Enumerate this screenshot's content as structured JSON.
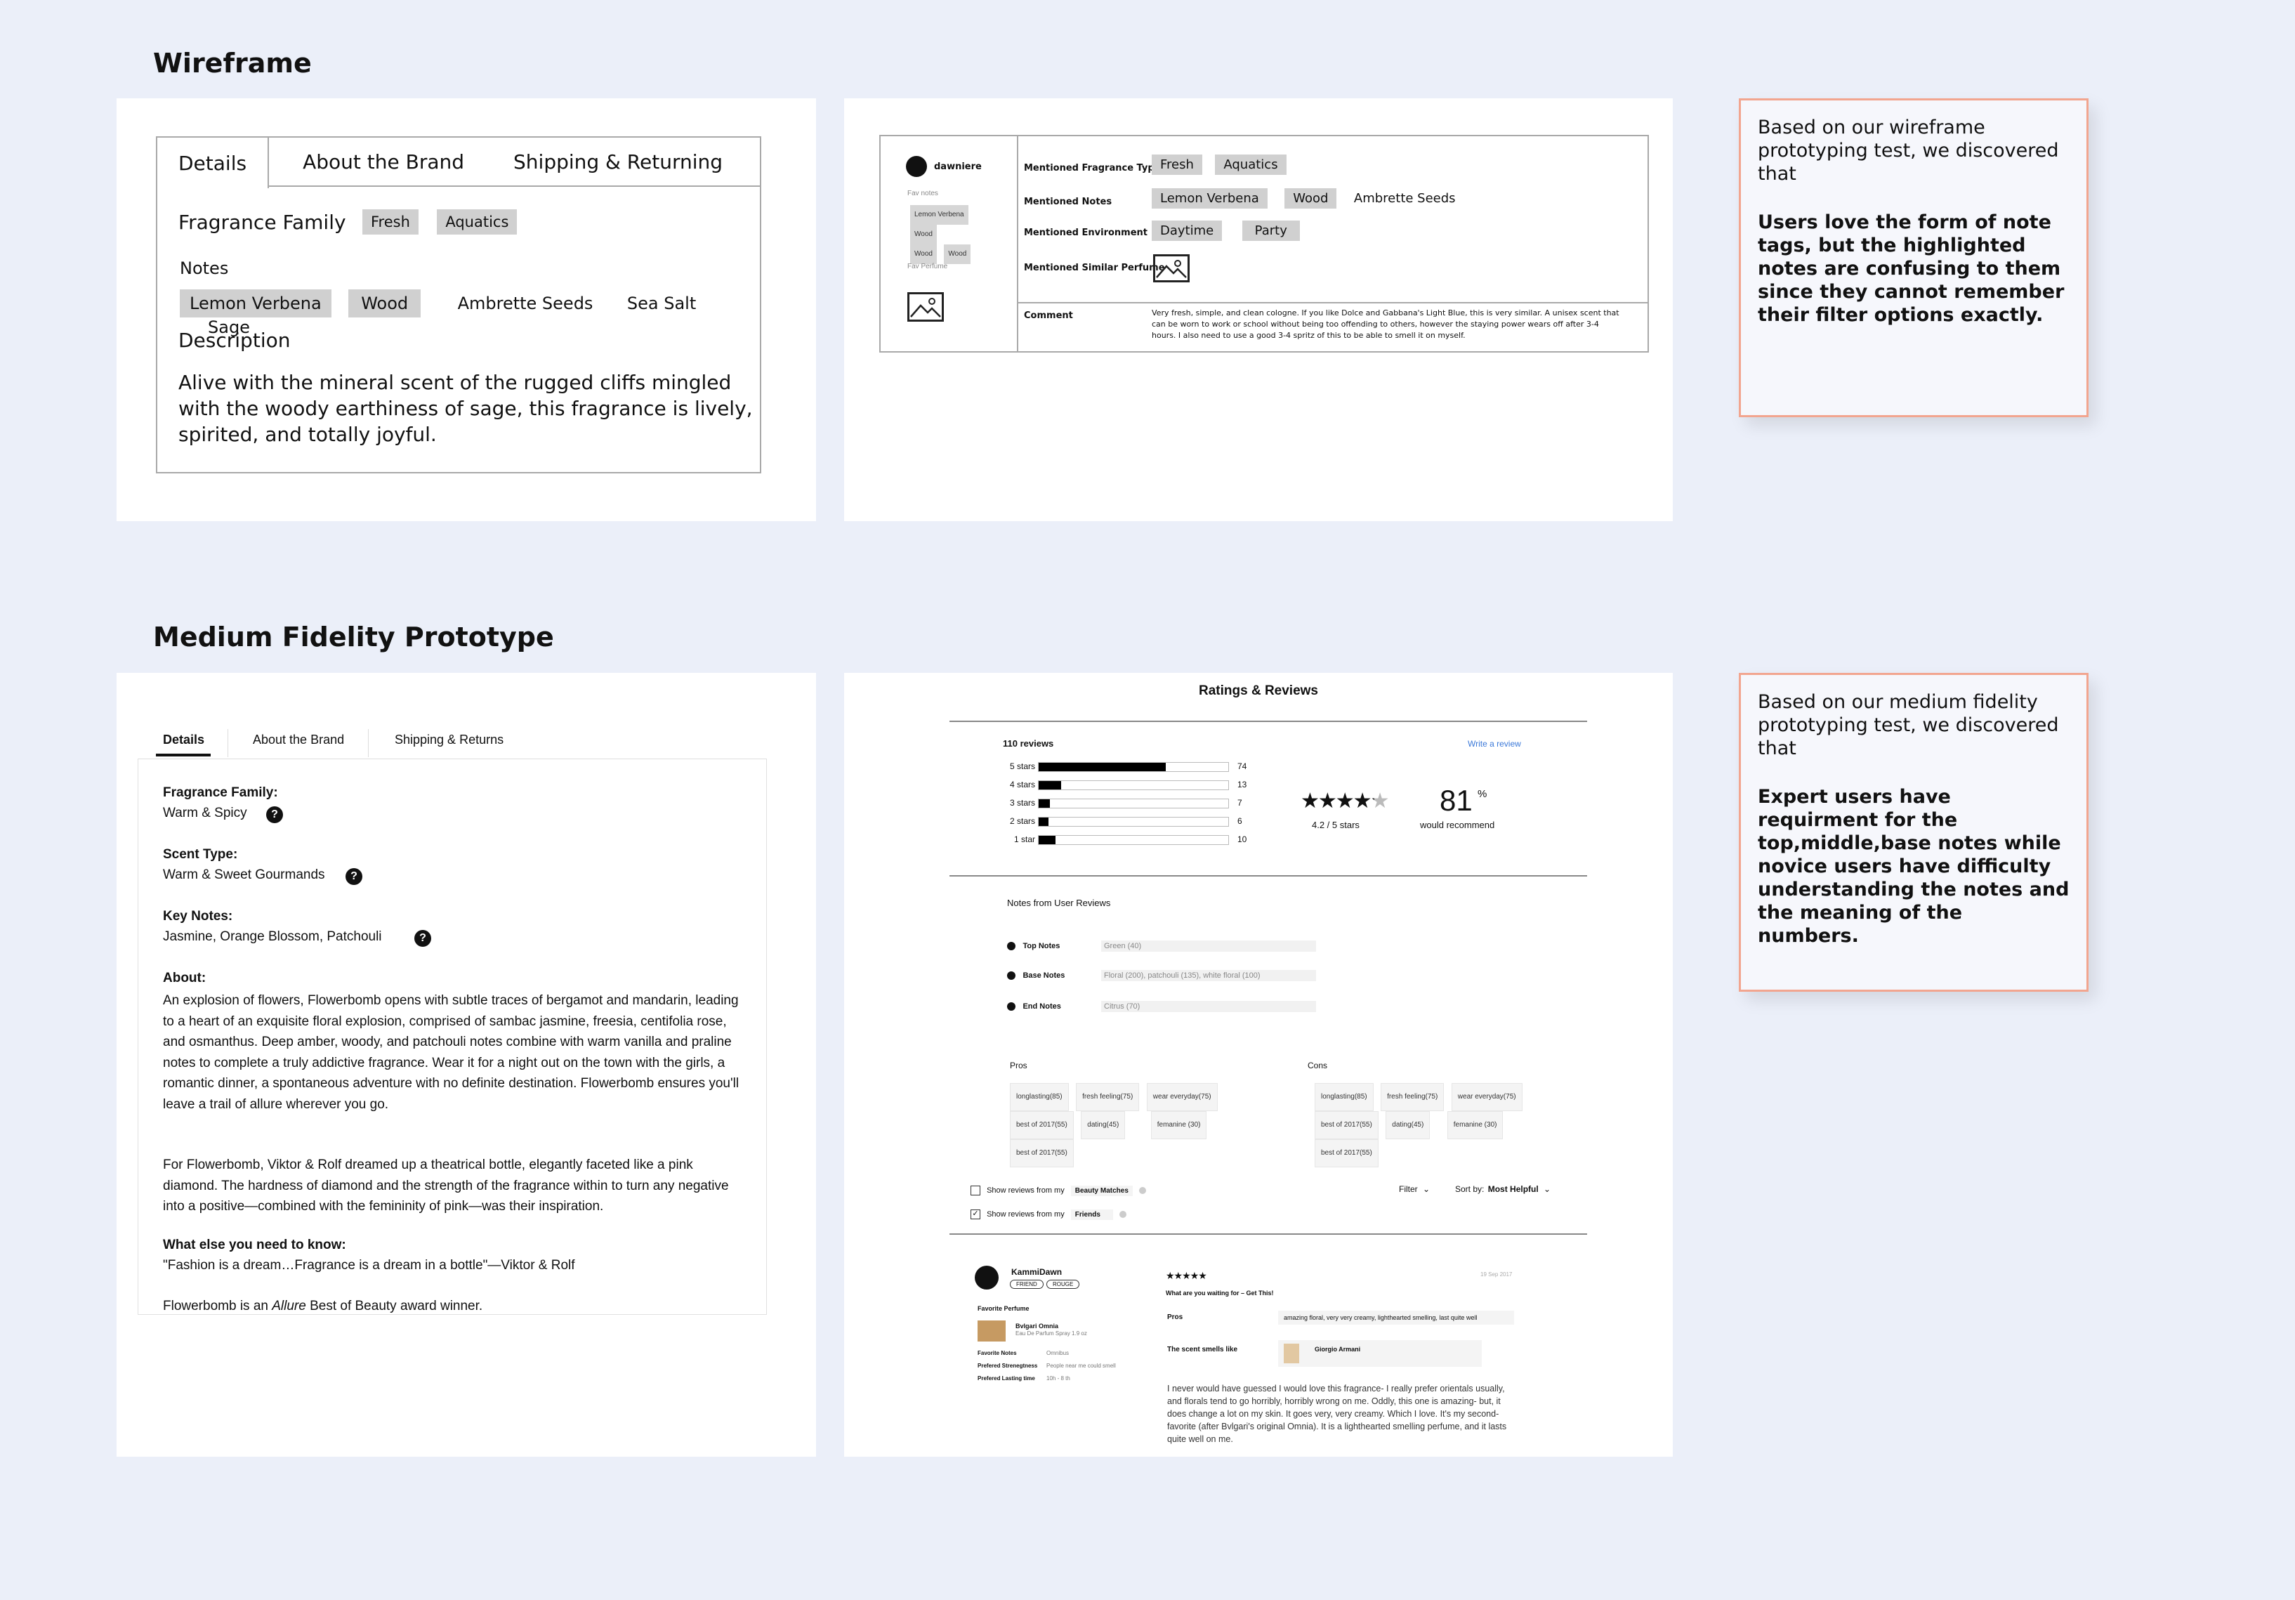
{
  "wireframe": {
    "title": "Wireframe",
    "details": {
      "tabs": [
        "Details",
        "About the Brand",
        "Shipping & Returning"
      ],
      "family_label": "Fragrance Family",
      "family_tags": [
        "Fresh",
        "Aquatics"
      ],
      "notes_label": "Notes",
      "note_tags": [
        "Lemon Verbena",
        "Wood"
      ],
      "note_plain": [
        "Ambrette Seeds",
        "Sea Salt",
        "Sage"
      ],
      "description_label": "Description",
      "description": "Alive with the mineral scent of the rugged cliffs mingled with the woody earthiness of sage, this fragrance is lively, spirited, and totally joyful."
    },
    "review": {
      "username": "dawniere",
      "fav_notes_label": "Fav notes",
      "fav_notes": [
        "Lemon Verbena",
        "Wood",
        "Wood",
        "Wood"
      ],
      "fav_perfume_label": "Fav Perfume",
      "rows": {
        "type_label": "Mentioned Fragrance Type",
        "type_tags": [
          "Fresh",
          "Aquatics"
        ],
        "notes_label": "Mentioned Notes",
        "notes_tags": [
          "Lemon Verbena",
          "Wood"
        ],
        "notes_plain": "Ambrette Seeds",
        "env_label": "Mentioned Environment",
        "env_tags": [
          "Daytime",
          "Party"
        ],
        "similar_label": "Mentioned Similar Perfume"
      },
      "comment_label": "Comment",
      "comment": "Very fresh, simple, and clean cologne. If you like Dolce and Gabbana's Light Blue, this is very similar. A unisex scent that can be worn to work or school without being too offending to others, however the staying power wears off after 3-4 hours. I also need to use a good 3-4 spritz of this to be able to smell it on myself."
    },
    "finding": {
      "intro": "Based on our wireframe prototyping test, we discovered that",
      "bold": "Users love the form of note tags, but the highlighted notes are confusing to them since they cannot remember their filter options exactly."
    }
  },
  "medium": {
    "title": "Medium Fidelity Prototype",
    "details": {
      "tabs": [
        "Details",
        "About the Brand",
        "Shipping & Returns"
      ],
      "family_label": "Fragrance Family:",
      "family_value": "Warm & Spicy",
      "scent_label": "Scent Type:",
      "scent_value": "Warm & Sweet Gourmands",
      "key_label": "Key Notes:",
      "key_value": "Jasmine, Orange Blossom, Patchouli",
      "about_label": "About:",
      "about_p1": "An explosion of flowers, Flowerbomb opens with subtle traces of bergamot and mandarin, leading to a heart of an exquisite floral explosion, comprised of sambac jasmine, freesia, centifolia rose, and osmanthus. Deep amber, woody, and patchouli notes combine with warm vanilla and praline notes to complete a truly addictive fragrance. Wear it for a night out on the town with the girls, a romantic dinner, a spontaneous adventure with no definite destination. Flowerbomb ensures you'll leave a trail of allure wherever you go.",
      "about_p2": "For Flowerbomb, Viktor & Rolf dreamed up a theatrical bottle, elegantly faceted like a pink diamond. The hardness of diamond and the strength of the fragrance within to turn any negative into a positive—combined with the femininity of pink—was their inspiration.",
      "know_label": "What else you need to know:",
      "know_value": "\"Fashion is a dream…Fragrance is a dream in a bottle\"—Viktor & Rolf",
      "award_pre": "Flowerbomb is an ",
      "award_em": "Allure",
      "award_post": " Best of Beauty award winner.",
      "help_glyph": "?"
    },
    "ratings": {
      "title": "Ratings & Reviews",
      "count": "110 reviews",
      "write": "Write a review",
      "bars": [
        {
          "label": "5 stars",
          "count": "74",
          "fraction": 0.67
        },
        {
          "label": "4 stars",
          "count": "13",
          "fraction": 0.12
        },
        {
          "label": "3 stars",
          "count": "7",
          "fraction": 0.06
        },
        {
          "label": "2 stars",
          "count": "6",
          "fraction": 0.05
        },
        {
          "label": "1 star",
          "count": "10",
          "fraction": 0.09
        }
      ],
      "stars": "★★★★★",
      "avg": "4.2 / 5 stars",
      "recommend_value": "81",
      "recommend_unit": "%",
      "recommend_label": "would recommend",
      "notes_title": "Notes from User Reviews",
      "notes": [
        {
          "label": "Top Notes",
          "value": "Green (40)"
        },
        {
          "label": "Base Notes",
          "value": "Floral (200), patchouli (135), white floral (100)"
        },
        {
          "label": "End Notes",
          "value": "Citrus (70)"
        }
      ],
      "pros_label": "Pros",
      "cons_label": "Cons",
      "pros": [
        "longlasting(85)",
        "fresh feeling(75)",
        "wear everyday(75)",
        "best of 2017(55)",
        "dating(45)",
        "femanine (30)",
        "best of 2017(55)"
      ],
      "cons": [
        "longlasting(85)",
        "fresh feeling(75)",
        "wear everyday(75)",
        "best of 2017(55)",
        "dating(45)",
        "femanine (30)",
        "best of 2017(55)"
      ],
      "filter1_text": "Show reviews from my",
      "filter1_badge": "Beauty Matches",
      "filter2_text": "Show reviews from my",
      "filter2_badge": "Friends",
      "filter_label": "Filter",
      "sort_label": "Sort by:",
      "sort_value": "Most Helpful",
      "review": {
        "username": "KammiDawn",
        "badges": [
          "FRIEND",
          "ROUGE"
        ],
        "fav_perfume_label": "Favorite Perfume",
        "fav_perfume_name": "Bvlgari Omnia",
        "fav_perfume_sub": "Eau De Parfum Spray 1.9 oz",
        "fav_notes_label": "Favorite Notes",
        "fav_notes_value": "Omnibus",
        "pref_strength_label": "Prefered Strenegtness",
        "pref_strength_value": "People near me could smell",
        "pref_lasting_label": "Prefered Lasting time",
        "pref_lasting_value": "10h - 8 th",
        "stars": "★★★★★",
        "date": "19 Sep 2017",
        "headline": "What are you waiting for – Get This!",
        "pros_label": "Pros",
        "pros_value": "amazing floral, very very creamy, lighthearted smelling, last quite well",
        "smells_label": "The scent smells like",
        "smells_value": "Giorgio Armani",
        "body": "I never would have guessed I would love this fragrance- I really prefer orientals usually, and florals tend to go horribly, horribly wrong on me. Oddly, this one is amazing- but, it does change a lot on my skin. It goes very, very creamy. Which I love. It's my second-favorite (after Bvlgari's original Omnia). It is a lighthearted smelling perfume, and it lasts quite well on me."
      }
    },
    "finding": {
      "intro": "Based on our medium fidelity prototyping test, we discovered that",
      "bold": "Expert users have requirment for the top,middle,base notes while novice users have difficulty understanding the notes and the meaning of the numbers."
    }
  },
  "colors": {
    "background": "#ebeff9",
    "note_border": "#f2a58f",
    "link": "#3a78d8"
  }
}
